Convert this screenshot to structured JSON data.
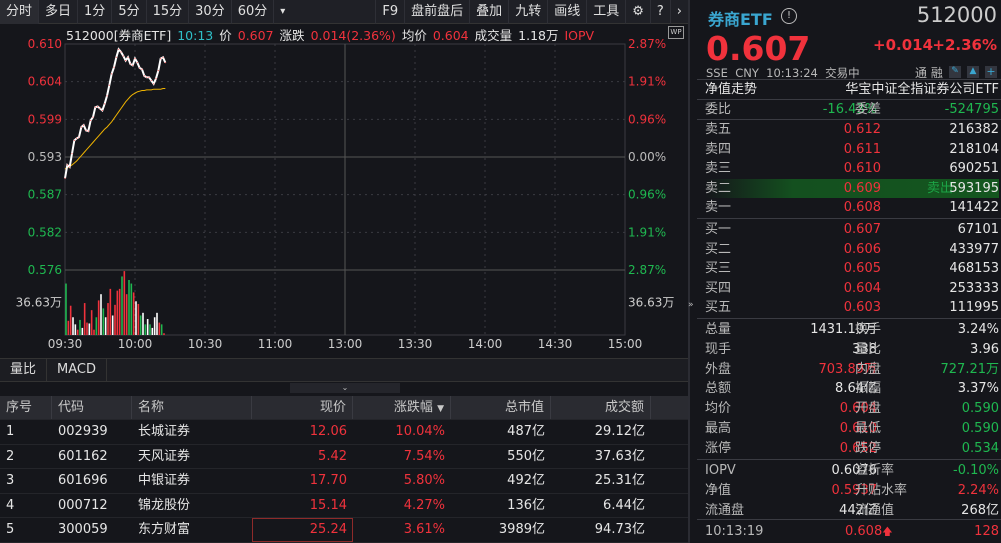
{
  "toolbar": {
    "periods": [
      "分时",
      "多日",
      "1分",
      "5分",
      "15分",
      "30分",
      "60分"
    ],
    "more": "▾",
    "right": [
      "F9",
      "盘前盘后",
      "叠加",
      "九转",
      "画线",
      "工具"
    ],
    "gear": "⚙",
    "help": "?",
    "next": "›"
  },
  "info": {
    "code_name": "512000[券商ETF]",
    "time": "10:13",
    "price_label": "价",
    "price": "0.607",
    "change_label": "涨跌",
    "change": "0.014(2.36%)",
    "avg_label": "均价",
    "avg": "0.604",
    "vol_label": "成交量",
    "vol": "1.18万",
    "iopv": "IOPV",
    "wp": "WP"
  },
  "chart_data": {
    "type": "line",
    "title": "512000[券商ETF] 分时",
    "ylim": [
      0.576,
      0.61
    ],
    "price_ticks": [
      "0.610",
      "0.604",
      "0.599",
      "0.593",
      "0.587",
      "0.582",
      "0.576"
    ],
    "pct_ticks": [
      "2.87%",
      "1.91%",
      "0.96%",
      "0.00%",
      "0.96%",
      "1.91%",
      "2.87%"
    ],
    "time_ticks": [
      "09:30",
      "10:00",
      "10:30",
      "11:00",
      "13:00",
      "13:30",
      "14:00",
      "14:30",
      "15:00"
    ],
    "volume_tick": "36.63万",
    "total_minutes": 240,
    "price": [
      0.5898,
      0.5918,
      0.5915,
      0.5935,
      0.5955,
      0.5958,
      0.596,
      0.5975,
      0.5978,
      0.597,
      0.5969,
      0.5985,
      0.599,
      0.6005,
      0.6006,
      0.6003,
      0.6,
      0.601,
      0.6022,
      0.6038,
      0.6055,
      0.6065,
      0.608,
      0.6092,
      0.6088,
      0.6082,
      0.6075,
      0.608,
      0.607,
      0.6068,
      0.6078,
      0.6072,
      0.6064,
      0.6062,
      0.6052,
      0.605,
      0.605,
      0.6045,
      0.604,
      0.6048,
      0.606,
      0.6078,
      0.608,
      0.6072
    ],
    "avg_price": [
      0.5912,
      0.5914,
      0.5916,
      0.5918,
      0.5921,
      0.5924,
      0.5928,
      0.5932,
      0.5936,
      0.594,
      0.5944,
      0.5948,
      0.5952,
      0.5956,
      0.596,
      0.5964,
      0.5968,
      0.5972,
      0.5975,
      0.5979,
      0.5983,
      0.5988,
      0.5993,
      0.5998,
      0.6003,
      0.6008,
      0.6013,
      0.6017,
      0.6021,
      0.6024,
      0.6026,
      0.6028,
      0.6029,
      0.603,
      0.603,
      0.6031,
      0.6031,
      0.6031,
      0.6032,
      0.6032,
      0.6032,
      0.6032,
      0.6033,
      0.6033
    ],
    "volume_wan": [
      58,
      16,
      33,
      20,
      12,
      6,
      17,
      8,
      36,
      14,
      13,
      28,
      6,
      20,
      39,
      46,
      30,
      20,
      36,
      52,
      22,
      34,
      50,
      52,
      66,
      72,
      46,
      62,
      58,
      48,
      38,
      35,
      22,
      25,
      12,
      18,
      12,
      8,
      20,
      25,
      14,
      12,
      2,
      0
    ],
    "volume_colors": [
      "g",
      "r",
      "r",
      "w",
      "w",
      "r",
      "g",
      "w",
      "r",
      "r",
      "w",
      "r",
      "r",
      "g",
      "r",
      "w",
      "g",
      "w",
      "r",
      "r",
      "w",
      "r",
      "r",
      "r",
      "g",
      "r",
      "r",
      "g",
      "g",
      "r",
      "w",
      "r",
      "g",
      "w",
      "g",
      "w",
      "g",
      "w",
      "w",
      "w",
      "r",
      "g",
      "r",
      "w"
    ],
    "colors": {
      "price": "#ffffff",
      "avg": "#f0b400",
      "up": "#f0323c",
      "down": "#1fb850",
      "flat": "#ffffff"
    }
  },
  "indicator_tabs": [
    "量比",
    "MACD"
  ],
  "collapse_icon": "⌄",
  "table": {
    "headers": [
      "序号",
      "代码",
      "名称",
      "现价",
      "涨跌幅",
      "总市值",
      "成交额"
    ],
    "sort_icon": "▼",
    "rows": [
      [
        "1",
        "002939",
        "长城证券",
        "12.06",
        "10.04%",
        "487亿",
        "29.12亿"
      ],
      [
        "2",
        "601162",
        "天风证券",
        "5.42",
        "7.54%",
        "550亿",
        "37.63亿"
      ],
      [
        "3",
        "601696",
        "中银证券",
        "17.70",
        "5.80%",
        "492亿",
        "25.31亿"
      ],
      [
        "4",
        "000712",
        "锦龙股份",
        "15.14",
        "4.27%",
        "136亿",
        "6.44亿"
      ],
      [
        "5",
        "300059",
        "东方财富",
        "25.24",
        "3.61%",
        "3989亿",
        "94.73亿"
      ]
    ]
  },
  "quote": {
    "name": "券商ETF",
    "info_icon": "!",
    "code": "512000",
    "price": "0.607",
    "change": "+0.014",
    "change_pct": "+2.36%",
    "exchange": "SSE",
    "currency": "CNY",
    "time": "10:13:24",
    "status": "交易中",
    "tong": "通",
    "rong": "融",
    "nav_trend": "净值走势",
    "fund_name": "华宝中证全指证券公司ETF",
    "weibi_label": "委比",
    "weibi": "-16.43%",
    "weicha_label": "委差",
    "weicha": "-524795"
  },
  "orderbook": {
    "sell": [
      [
        "卖五",
        "0.612",
        "216382"
      ],
      [
        "卖四",
        "0.611",
        "218104"
      ],
      [
        "卖三",
        "0.610",
        "690251"
      ],
      [
        "卖二",
        "0.609",
        "593195"
      ],
      [
        "卖一",
        "0.608",
        "141422"
      ]
    ],
    "sell_flash": "卖出",
    "buy": [
      [
        "买一",
        "0.607",
        "67101"
      ],
      [
        "买二",
        "0.606",
        "433977"
      ],
      [
        "买三",
        "0.605",
        "468153"
      ],
      [
        "买四",
        "0.604",
        "253333"
      ],
      [
        "买五",
        "0.603",
        "111995"
      ]
    ]
  },
  "stats": [
    [
      "总量",
      "1431.10万",
      "w",
      "换手",
      "3.24%",
      "w"
    ],
    [
      "现手",
      "338",
      "w",
      "量比",
      "3.96",
      "w"
    ],
    [
      "外盘",
      "703.89万",
      "r",
      "内盘",
      "727.21万",
      "g"
    ],
    [
      "总额",
      "8.64亿",
      "w",
      "振幅",
      "3.37%",
      "w"
    ],
    [
      "均价",
      "0.604",
      "r",
      "开盘",
      "0.590",
      "g"
    ],
    [
      "最高",
      "0.610",
      "r",
      "最低",
      "0.590",
      "g"
    ],
    [
      "涨停",
      "0.652",
      "r",
      "跌停",
      "0.534",
      "g"
    ]
  ],
  "fund_stats": [
    [
      "IOPV",
      "0.6076",
      "w",
      "溢折率",
      "-0.10%",
      "g"
    ],
    [
      "净值",
      "0.5937",
      "r",
      "升贴水率",
      "2.24%",
      "r"
    ],
    [
      "流通盘",
      "442亿",
      "w",
      "流通值",
      "268亿",
      "w"
    ]
  ],
  "tick": {
    "time": "10:13:19",
    "price": "0.608",
    "arrow": "🡅",
    "volume": "128"
  },
  "expand_icon": "»"
}
